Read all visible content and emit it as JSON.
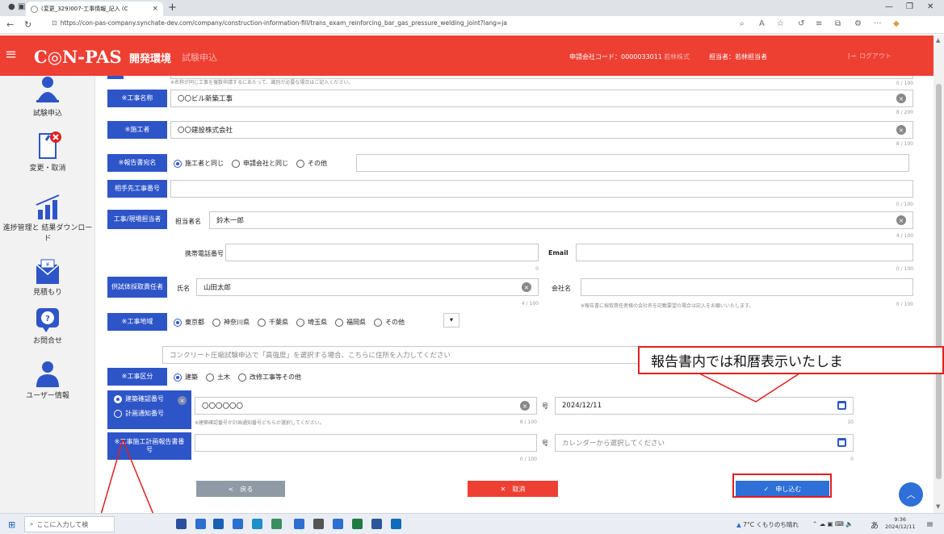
{
  "browser": {
    "tab_title": "(変更_329)007-工事情報_記入 (C",
    "tab_close": "×",
    "new_tab": "+",
    "url": "https://con-pas-company.synchate-dev.com/company/construction-information-fill/trans_exam_reinforcing_bar_gas_pressure_welding_joint?lang=ja"
  },
  "header": {
    "logo": "C◎N-PAS",
    "env_label": "開発環境",
    "sub_label": "試験申込",
    "company_code": "申請会社コード：0000033011",
    "company_name": "若林株式",
    "person": "担当者：若林担当者",
    "logout": "ログアウト"
  },
  "sidebar": {
    "items": [
      {
        "label": "試験申込",
        "icon": "person-icon"
      },
      {
        "label": "変更・取消",
        "icon": "document-cancel-icon"
      },
      {
        "label": "進捗管理と 結果ダウンロード",
        "icon": "chart-icon"
      },
      {
        "label": "見積もり",
        "icon": "yen-envelope-icon"
      },
      {
        "label": "お問合せ",
        "icon": "question-icon"
      },
      {
        "label": "ユーザー情報",
        "icon": "user-icon"
      }
    ]
  },
  "form": {
    "top_note": "※名称が同じ工事を複数申請するにあたって、識別が必要な場合はご記入ください。",
    "top_count": "0 / 100",
    "project_name": {
      "label": "※工事名称",
      "value": "〇〇ビル新築工事",
      "count": "8 / 200"
    },
    "contractor": {
      "label": "※施工者",
      "value": "〇〇建設株式会社",
      "count": "8 / 100"
    },
    "report_addressee": {
      "label": "※報告書宛名",
      "options": [
        "施工者と同じ",
        "申請会社と同じ",
        "その他"
      ],
      "selected": 0
    },
    "client_project_no": {
      "label": "相手先工事番号",
      "count": "0 / 100"
    },
    "site_manager": {
      "label": "工事/現場担当者",
      "name_label": "担当者名",
      "name_value": "鈴木一郎",
      "name_count": "4 / 100",
      "phone_label": "携帯電話番号",
      "phone_count": "0",
      "email_label": "Email",
      "email_count": "0 / 100"
    },
    "sampler": {
      "label": "供試体採取責任者",
      "name_label": "氏名",
      "name_value": "山田太郎",
      "name_count": "4 / 100",
      "company_label": "会社名",
      "company_note": "※報告書に採取責任者様の会社名を記載要望の場合は記入をお願いいたします。",
      "company_count": "0 / 100"
    },
    "region": {
      "label": "※工事地域",
      "options": [
        "東京都",
        "神奈川県",
        "千葉県",
        "埼玉県",
        "福岡県",
        "その他"
      ],
      "selected": 0,
      "address_placeholder": "コンクリート圧縮試験申込で「高強度」を選択する場合、こちらに住所を入力してください"
    },
    "work_type": {
      "label": "※工事区分",
      "options": [
        "建築",
        "土木",
        "改修工事等その他"
      ],
      "selected": 0
    },
    "confirm_no": {
      "option1": "建築確認番号",
      "option2": "計画通知番号",
      "value": "〇〇〇〇〇〇",
      "note": "※建築確認番号か計画通知番号どちらか選択してください。",
      "count": "6 / 100",
      "go_label": "号",
      "date_value": "2024/12/11",
      "date_count": "10"
    },
    "plan_report": {
      "label": "※工事施工計画報告書番号",
      "count": "0 / 100",
      "go_label": "号",
      "date_placeholder": "カレンダーから選択してください",
      "date_count": "0"
    }
  },
  "buttons": {
    "back": "<　戻る",
    "cancel": "✕　取消",
    "submit": "✓　申し込む",
    "back_color": "#8f9aa5",
    "cancel_color": "#ee3f33",
    "submit_color": "#2e6fd8"
  },
  "annotation": {
    "callout_text": "報告書内では和暦表示いたしま"
  },
  "taskbar": {
    "search_placeholder": "ここに入力して検",
    "weather": "7°C くもりのち晴れ",
    "ime": "あ",
    "time": "9:36",
    "date": "2024/12/11"
  }
}
